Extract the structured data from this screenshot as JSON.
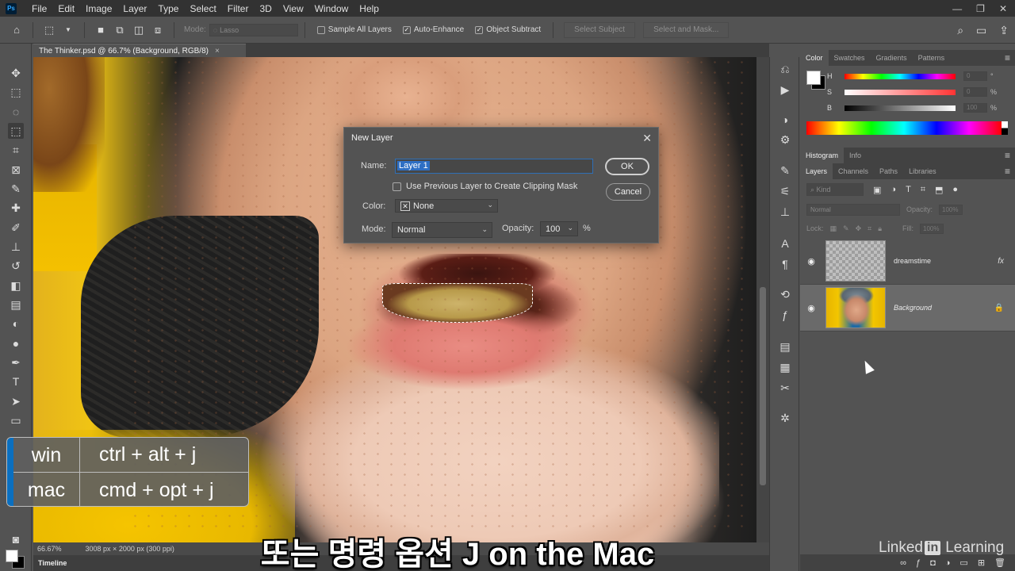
{
  "app": {
    "logo": "Ps"
  },
  "menu": [
    "File",
    "Edit",
    "Image",
    "Layer",
    "Type",
    "Select",
    "Filter",
    "3D",
    "View",
    "Window",
    "Help"
  ],
  "window_controls": {
    "minimize": "—",
    "restore": "❐",
    "close": "✕"
  },
  "options": {
    "mode_label": "Mode:",
    "mode_value": "Lasso",
    "sample_all_layers": "Sample All Layers",
    "auto_enhance": "Auto-Enhance",
    "object_subtract": "Object Subtract",
    "select_subject": "Select Subject",
    "select_and_mask": "Select and Mask..."
  },
  "document": {
    "tab_title": "The Thinker.psd @ 66.7% (Background, RGB/8)",
    "tab_close": "×",
    "zoom": "66.67%",
    "size_info": "3008 px × 2000 px (300 ppi)"
  },
  "timeline": {
    "label": "Timeline"
  },
  "shortcut": {
    "win_label": "win",
    "win_keys": "ctrl + alt + j",
    "mac_label": "mac",
    "mac_keys": "cmd + opt + j"
  },
  "subtitle": "또는 명령 옵션 J on the Mac",
  "color_panel": {
    "tabs": [
      "Color",
      "Swatches",
      "Gradients",
      "Patterns"
    ],
    "channels": [
      {
        "label": "H",
        "value": "0",
        "unit": "°"
      },
      {
        "label": "S",
        "value": "0",
        "unit": "%"
      },
      {
        "label": "B",
        "value": "100",
        "unit": "%"
      }
    ]
  },
  "histogram_tabs": [
    "Histogram",
    "Info"
  ],
  "layers_panel": {
    "tabs": [
      "Layers",
      "Channels",
      "Paths",
      "Libraries"
    ],
    "kind_placeholder": "Kind",
    "blend_mode": "Normal",
    "opacity_label": "Opacity:",
    "opacity_value": "100%",
    "lock_label": "Lock:",
    "fill_label": "Fill:",
    "fill_value": "100%",
    "layers": [
      {
        "name": "dreamstime",
        "badge": "fx"
      },
      {
        "name": "Background",
        "badge": "🔒"
      }
    ]
  },
  "dialog": {
    "title": "New Layer",
    "name_label": "Name:",
    "name_value": "Layer 1",
    "clipping_label": "Use Previous Layer to Create Clipping Mask",
    "color_label": "Color:",
    "color_value": "None",
    "mode_label": "Mode:",
    "mode_value": "Normal",
    "opacity_label": "Opacity:",
    "opacity_value": "100",
    "opacity_unit": "%",
    "ok": "OK",
    "cancel": "Cancel"
  },
  "watermark": {
    "text_a": "Linked",
    "text_in": "in",
    "text_b": "Learning"
  },
  "colors": {
    "accent": "#0a6fc0",
    "selection": "#2e6fc4"
  }
}
